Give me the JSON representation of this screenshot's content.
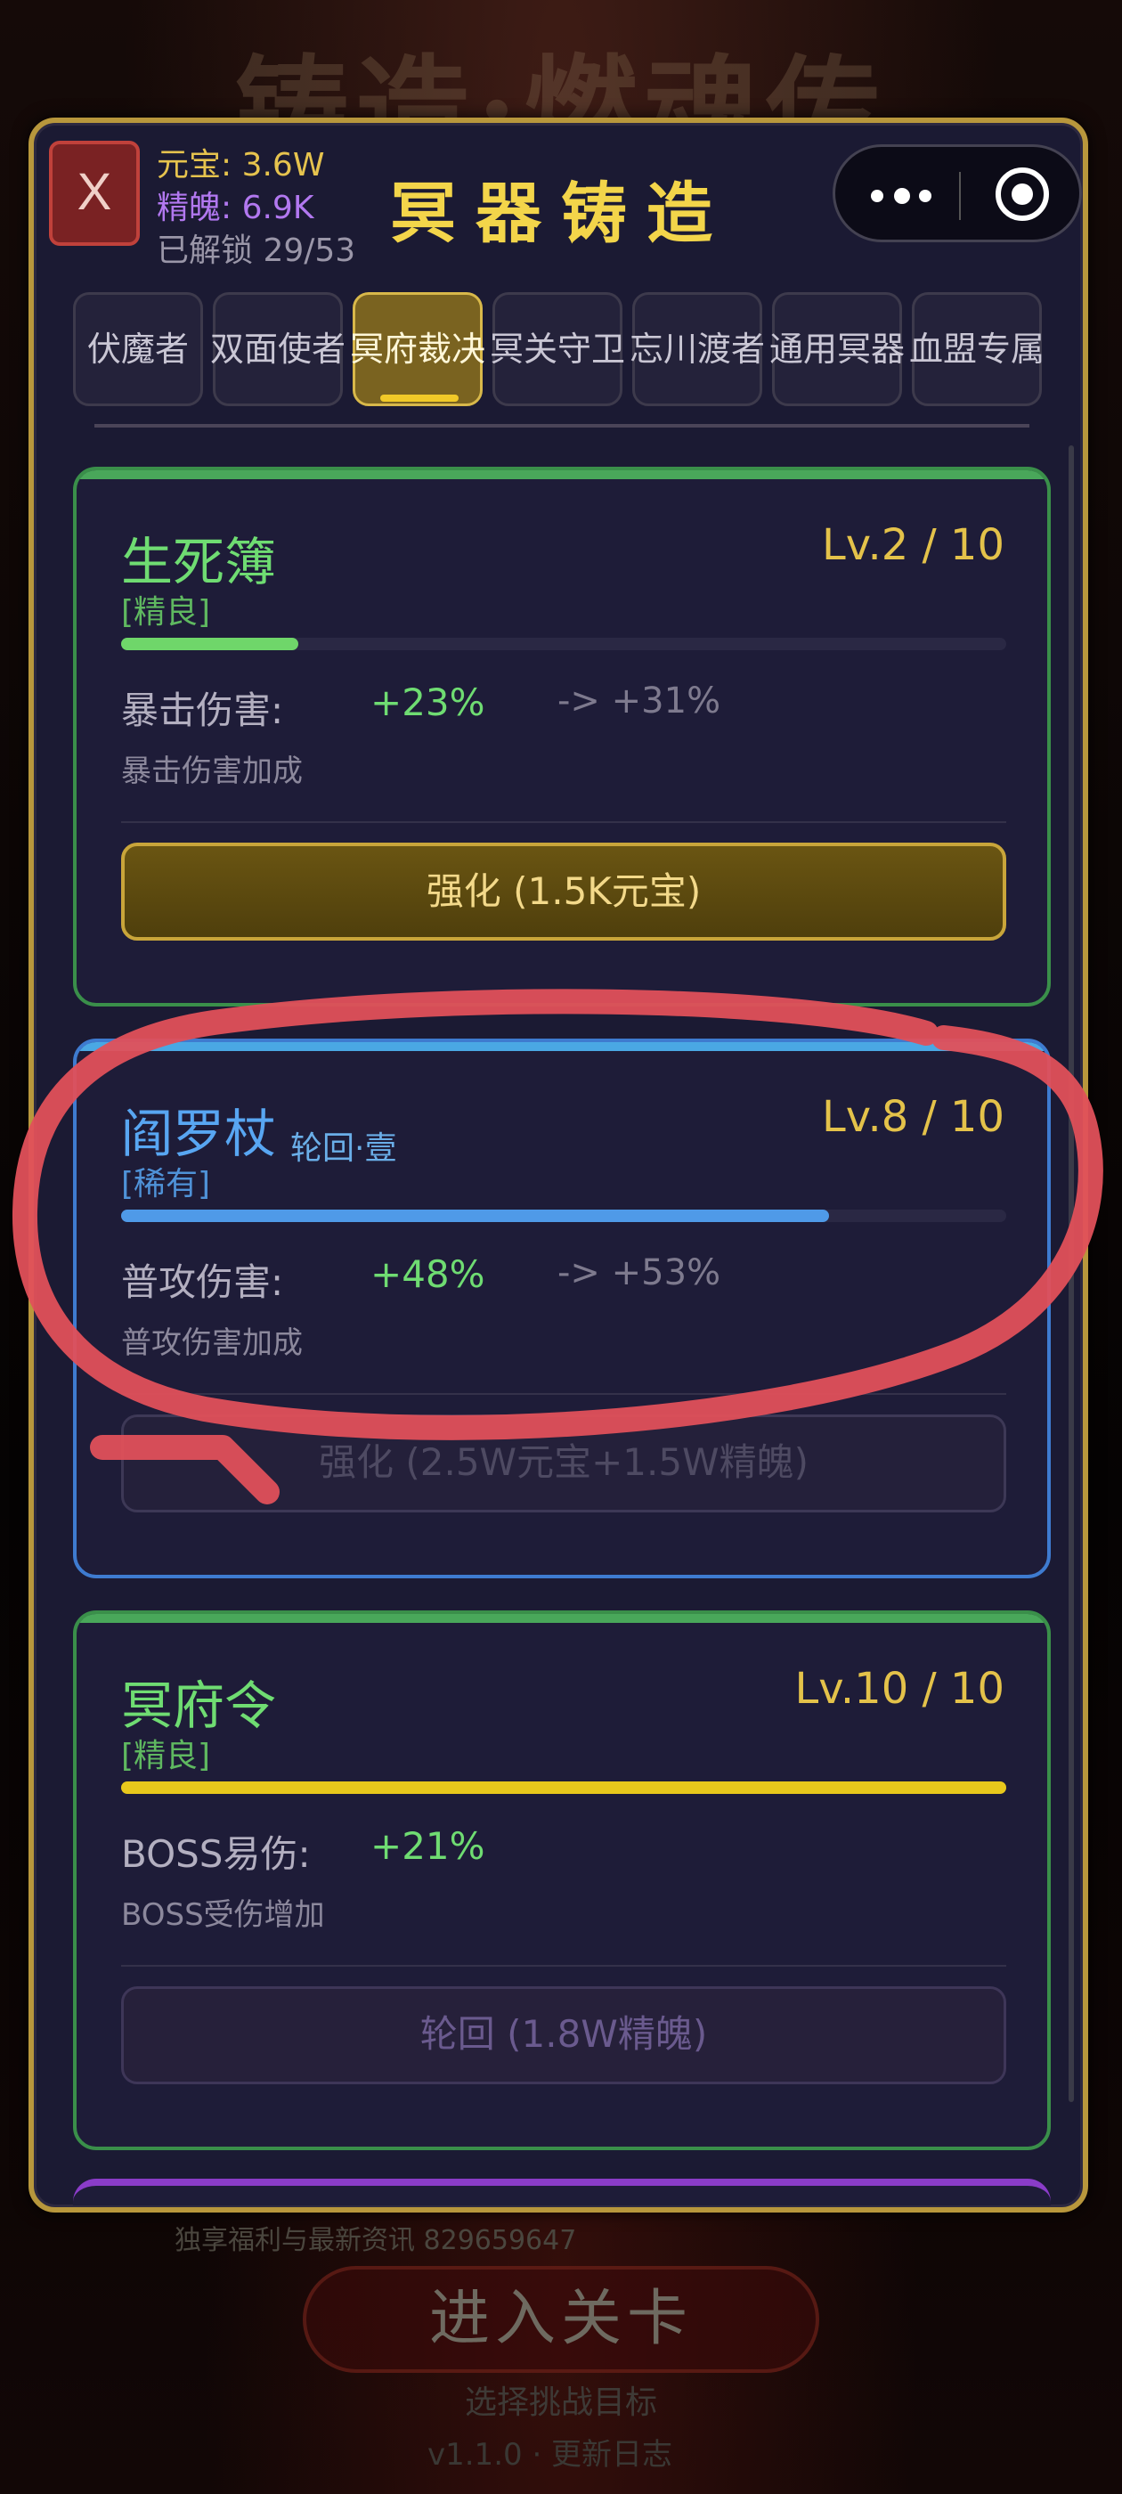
{
  "background": {
    "title": "铸造·燃魂传"
  },
  "resources": {
    "yuanbao": "元宝: 3.6W",
    "jingpo": "精魄: 6.9K",
    "unlocked": "已解锁 29/53"
  },
  "close_label": "X",
  "title": "冥器铸造",
  "tabs": [
    {
      "label": "伏魔者",
      "active": false
    },
    {
      "label": "双面使者",
      "active": false
    },
    {
      "label": "冥府裁决",
      "active": true
    },
    {
      "label": "冥关守卫",
      "active": false
    },
    {
      "label": "忘川渡者",
      "active": false
    },
    {
      "label": "通用冥器",
      "active": false
    },
    {
      "label": "血盟专属",
      "active": false
    }
  ],
  "cards": [
    {
      "name": "生死簿",
      "tag": "",
      "rarity": "[精良]",
      "level": "Lv.2 / 10",
      "progress": 0.2,
      "stat_label": "暴击伤害:",
      "stat_value": "+23%",
      "stat_next": "-> +31%",
      "description": "暴击伤害加成",
      "button": "强化 (1.5K元宝)",
      "bar_color": "#6fd66a"
    },
    {
      "name": "阎罗杖",
      "tag": "轮回·壹",
      "rarity": "[稀有]",
      "level": "Lv.8 / 10",
      "progress": 0.8,
      "stat_label": "普攻伤害:",
      "stat_value": "+48%",
      "stat_next": "-> +53%",
      "description": "普攻伤害加成",
      "button": "强化 (2.5W元宝+1.5W精魄)",
      "bar_color": "#4f9ae8"
    },
    {
      "name": "冥府令",
      "tag": "",
      "rarity": "[精良]",
      "level": "Lv.10 / 10",
      "progress": 1.0,
      "stat_label": "BOSS易伤:",
      "stat_value": "+21%",
      "stat_next": "",
      "description": "BOSS受伤增加",
      "button": "轮回 (1.8W精魄)",
      "bar_color": "#e8c81c"
    }
  ],
  "bottom": {
    "note": "独享福利与最新资讯 829659647",
    "enter_button": "进入关卡",
    "enter_sub": "选择挑战目标",
    "version": "v1.1.0 · 更新日志"
  },
  "colors": {
    "panel_border": "#b8973c",
    "annotation": "#e0505a"
  }
}
